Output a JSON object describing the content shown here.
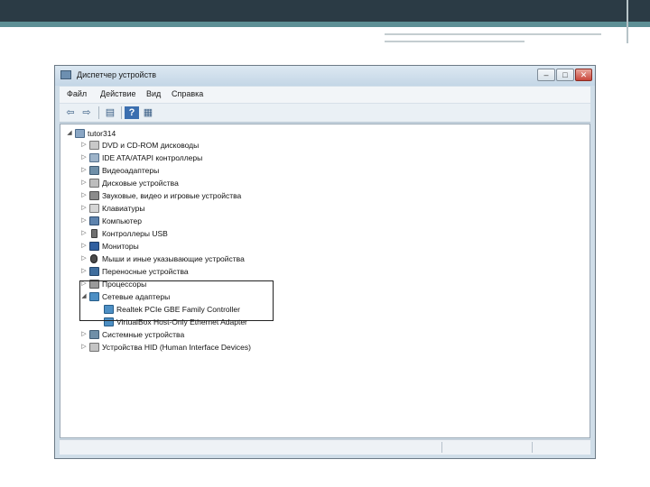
{
  "window": {
    "title": "Диспетчер устройств",
    "buttons": {
      "minimize": "–",
      "maximize": "□",
      "close": "✕"
    }
  },
  "menu": [
    "Файл",
    "Действие",
    "Вид",
    "Справка"
  ],
  "toolbar": {
    "icons": [
      "back-arrow-icon",
      "forward-arrow-icon",
      "properties-icon",
      "help-icon",
      "view-icon"
    ],
    "glyphs": {
      "back": "⇦",
      "forward": "⇨",
      "properties": "▤",
      "help": "?",
      "view": "▦"
    }
  },
  "tree": {
    "root": {
      "label": "tutor314",
      "expander": "◢"
    },
    "categories": [
      {
        "label": "DVD и CD-ROM дисководы",
        "expander": "▷",
        "icon": "dvd-drive-icon"
      },
      {
        "label": "IDE ATA/ATAPI контроллеры",
        "expander": "▷",
        "icon": "ide-controller-icon"
      },
      {
        "label": "Видеоадаптеры",
        "expander": "▷",
        "icon": "video-adapter-icon"
      },
      {
        "label": "Дисковые устройства",
        "expander": "▷",
        "icon": "disk-drive-icon"
      },
      {
        "label": "Звуковые, видео и игровые устройства",
        "expander": "▷",
        "icon": "sound-device-icon"
      },
      {
        "label": "Клавиатуры",
        "expander": "▷",
        "icon": "keyboard-icon"
      },
      {
        "label": "Компьютер",
        "expander": "▷",
        "icon": "computer-icon"
      },
      {
        "label": "Контроллеры USB",
        "expander": "▷",
        "icon": "usb-controller-icon"
      },
      {
        "label": "Мониторы",
        "expander": "▷",
        "icon": "monitor-icon"
      },
      {
        "label": "Мыши и иные указывающие устройства",
        "expander": "▷",
        "icon": "mouse-icon"
      },
      {
        "label": "Переносные устройства",
        "expander": "▷",
        "icon": "portable-device-icon"
      },
      {
        "label": "Процессоры",
        "expander": "▷",
        "icon": "processor-icon"
      },
      {
        "label": "Сетевые адаптеры",
        "expander": "◢",
        "icon": "network-adapter-icon",
        "children": [
          {
            "label": "Realtek PCIe GBE Family Controller",
            "icon": "network-card-icon"
          },
          {
            "label": "VirtualBox Host-Only Ethernet Adapter",
            "icon": "network-card-icon"
          }
        ]
      },
      {
        "label": "Системные устройства",
        "expander": "▷",
        "icon": "system-device-icon"
      },
      {
        "label": "Устройства HID (Human Interface Devices)",
        "expander": "▷",
        "icon": "hid-device-icon"
      }
    ]
  },
  "colors": {
    "slide_dark": "#2b3b45",
    "slide_accent": "#5d8f95",
    "window_frame": "#cfdde8",
    "highlight_border": "#222222"
  }
}
